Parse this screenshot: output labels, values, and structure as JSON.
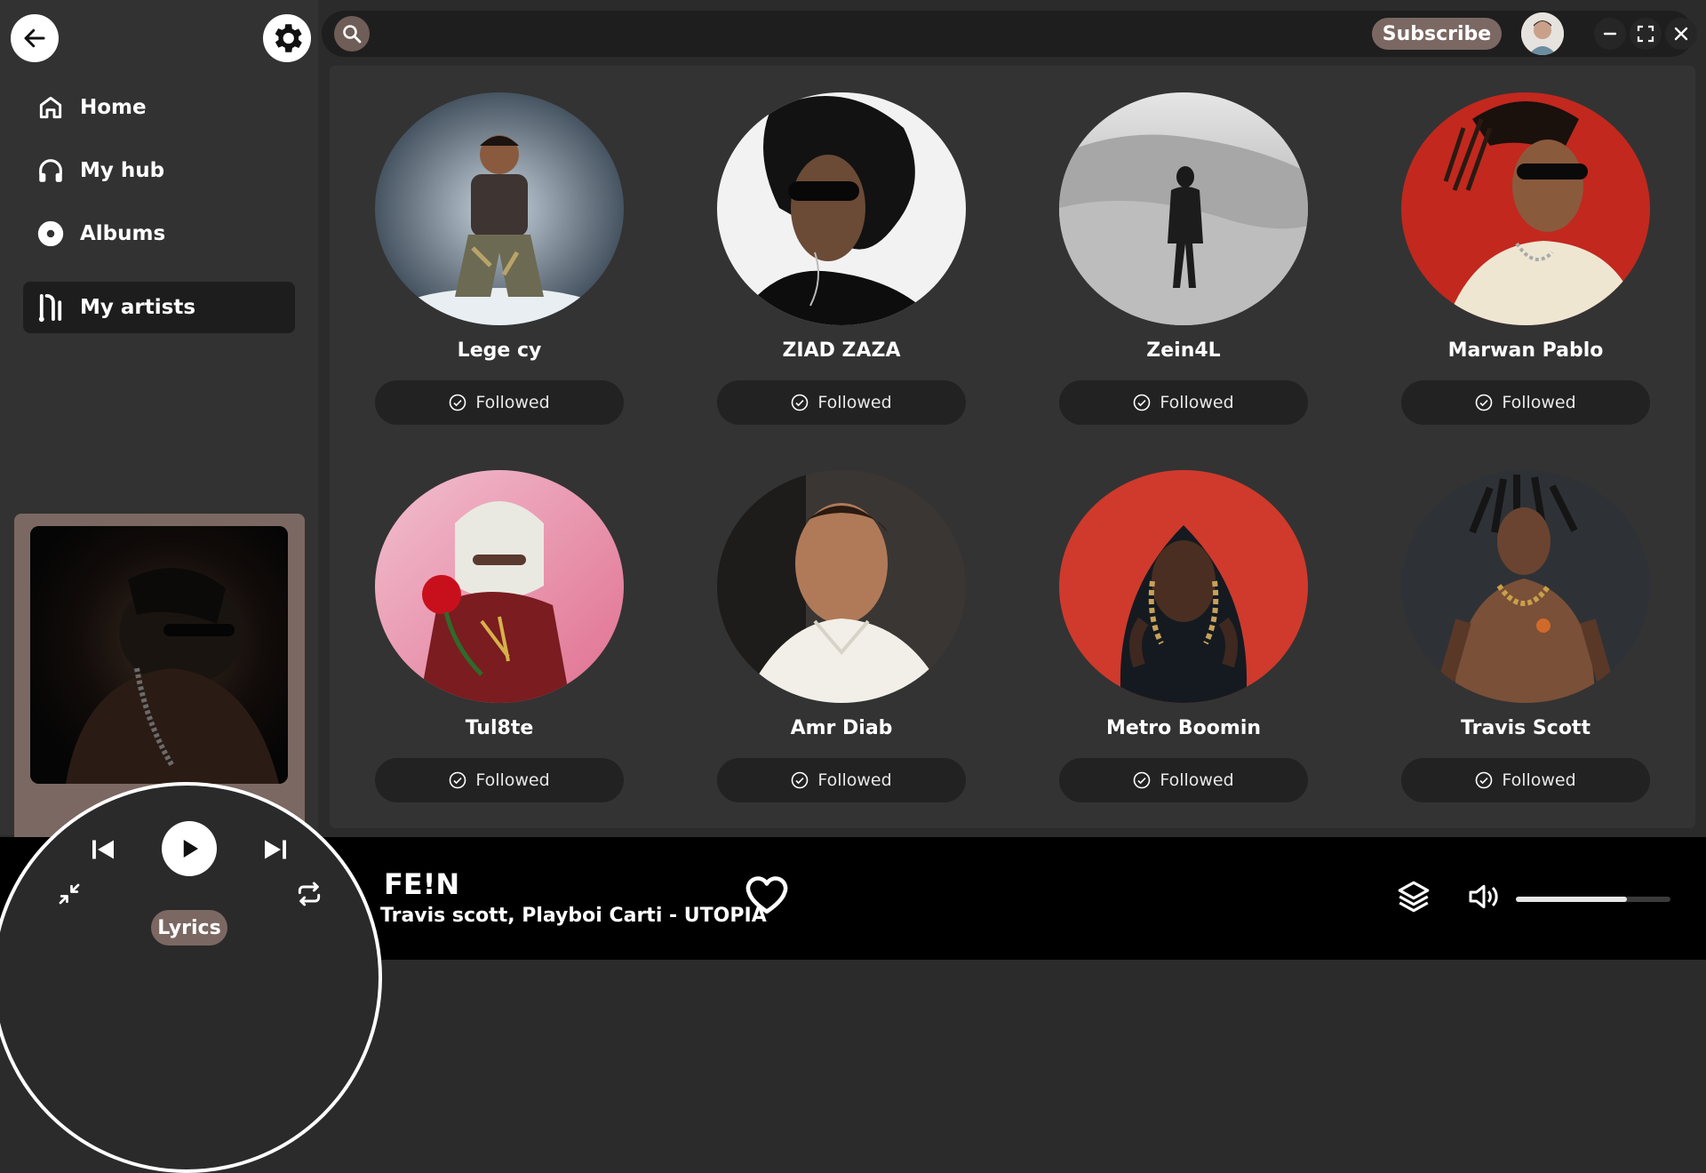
{
  "sidebar": {
    "items": [
      {
        "label": "Home",
        "icon": "home-icon"
      },
      {
        "label": "My hub",
        "icon": "headphones-icon"
      },
      {
        "label": "Albums",
        "icon": "disc-icon"
      },
      {
        "label": "My artists",
        "icon": "artist-icon",
        "active": true
      }
    ]
  },
  "topbar": {
    "subscribe_label": "Subscribe"
  },
  "artists": [
    {
      "name": "Lege cy",
      "status": "Followed"
    },
    {
      "name": "ZIAD ZAZA",
      "status": "Followed"
    },
    {
      "name": "Zein4L",
      "status": "Followed"
    },
    {
      "name": "Marwan Pablo",
      "status": "Followed"
    },
    {
      "name": "Tul8te",
      "status": "Followed"
    },
    {
      "name": "Amr Diab",
      "status": "Followed"
    },
    {
      "name": "Metro Boomin",
      "status": "Followed"
    },
    {
      "name": "Travis Scott",
      "status": "Followed"
    }
  ],
  "player": {
    "track_title": "FE!N",
    "track_subtitle": "Travis scott, Playboi Carti - UTOPIA",
    "lyrics_label": "Lyrics",
    "volume": 0.72
  },
  "colors": {
    "accent": "#7b6863",
    "background": "#2b2b2b",
    "panel": "#333333"
  }
}
